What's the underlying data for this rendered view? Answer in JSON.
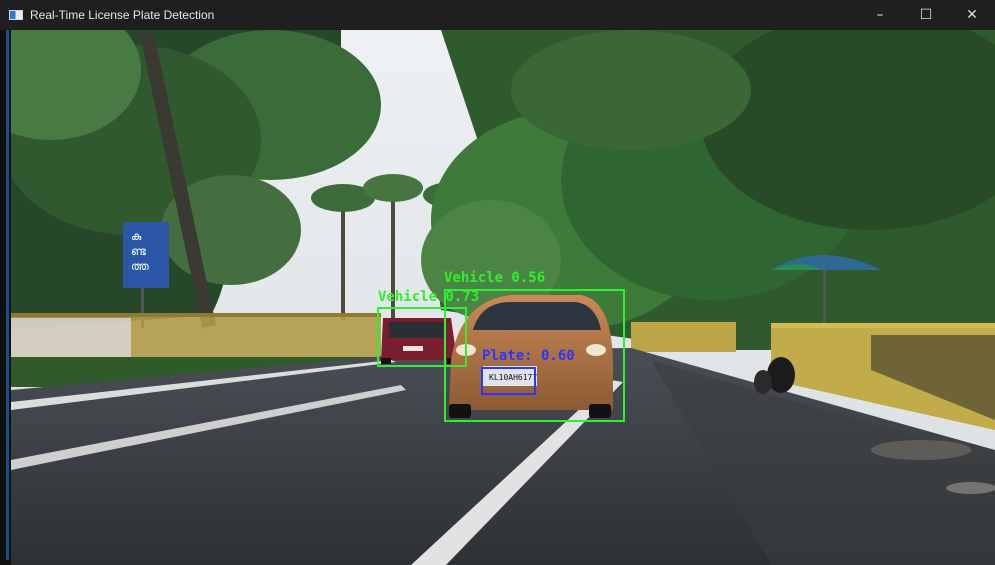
{
  "window": {
    "title": "Real-Time License Plate Detection",
    "controls": {
      "minimize": "–",
      "maximize": "☐",
      "close": "✕"
    }
  },
  "scene": {
    "signboard_text": [
      "കു",
      "ണ്ട",
      "ത്ത"
    ],
    "plate_text": "KL10AH6177"
  },
  "detections": [
    {
      "class": "Vehicle",
      "score": "0.73",
      "label": "Vehicle 0.73",
      "color": "#2ef02e"
    },
    {
      "class": "Vehicle",
      "score": "0.56",
      "label": "Vehicle 0.56",
      "color": "#2ef02e"
    },
    {
      "class": "Plate",
      "score": "0.60",
      "label": "Plate: 0.60",
      "color": "#2b35ff"
    }
  ]
}
